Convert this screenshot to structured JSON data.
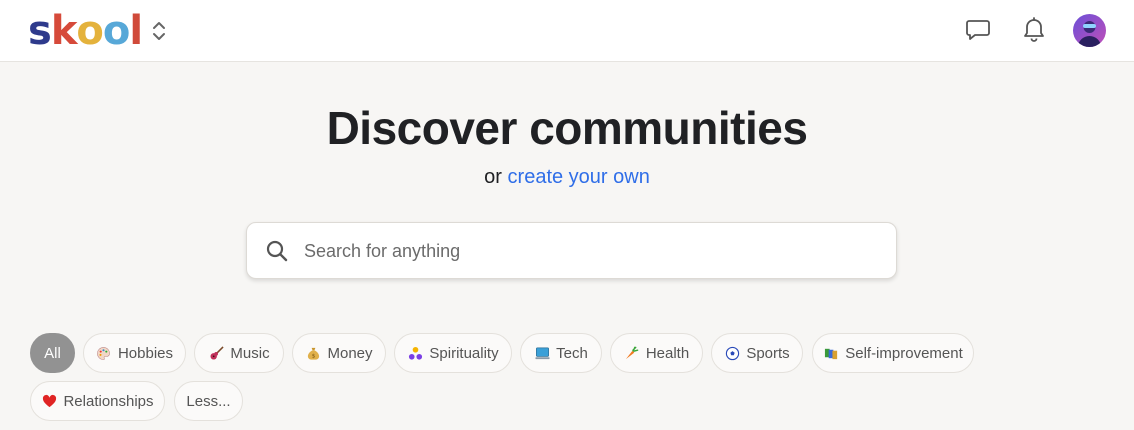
{
  "header": {
    "logo_letters": [
      {
        "char": "s",
        "color": "#2e3a8c"
      },
      {
        "char": "k",
        "color": "#d64a3a"
      },
      {
        "char": "o",
        "color": "#e4b23c"
      },
      {
        "char": "o",
        "color": "#57a8d8"
      },
      {
        "char": "l",
        "color": "#d04a3a"
      }
    ],
    "icons": [
      "chevron-up-down-icon",
      "chat-icon",
      "bell-icon",
      "avatar"
    ]
  },
  "hero": {
    "title": "Discover communities",
    "sub_prefix": "or",
    "sub_link": "create your own"
  },
  "search": {
    "placeholder": "Search for anything",
    "value": ""
  },
  "categories": [
    {
      "label": "All",
      "icon": "",
      "active": true
    },
    {
      "label": "Hobbies",
      "icon": "palette-icon",
      "active": false
    },
    {
      "label": "Music",
      "icon": "guitar-icon",
      "active": false
    },
    {
      "label": "Money",
      "icon": "money-bag-icon",
      "active": false
    },
    {
      "label": "Spirituality",
      "icon": "triangle-dots-icon",
      "active": false
    },
    {
      "label": "Tech",
      "icon": "computer-icon",
      "active": false
    },
    {
      "label": "Health",
      "icon": "carrot-icon",
      "active": false
    },
    {
      "label": "Sports",
      "icon": "soccer-ball-icon",
      "active": false
    },
    {
      "label": "Self-improvement",
      "icon": "books-icon",
      "active": false
    },
    {
      "label": "Relationships",
      "icon": "heart-icon",
      "active": false
    },
    {
      "label": "Less...",
      "icon": "",
      "active": false
    }
  ],
  "colors": {
    "accent_link": "#2f6ee8",
    "active_chip": "#929292",
    "page_bg": "#f7f6f4"
  }
}
